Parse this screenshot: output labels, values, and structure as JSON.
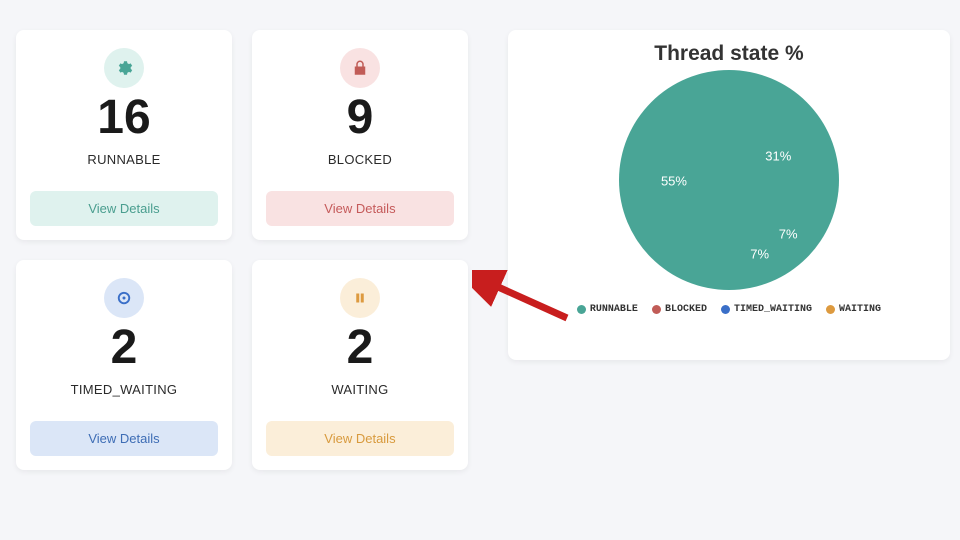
{
  "cards": [
    {
      "id": "runnable",
      "icon": "gear-icon",
      "value": "16",
      "label": "RUNNABLE",
      "button": "View Details",
      "variant": "teal"
    },
    {
      "id": "blocked",
      "icon": "lock-icon",
      "value": "9",
      "label": "BLOCKED",
      "button": "View Details",
      "variant": "red"
    },
    {
      "id": "timed-waiting",
      "icon": "clock-icon",
      "value": "2",
      "label": "TIMED_WAITING",
      "button": "View Details",
      "variant": "blue"
    },
    {
      "id": "waiting",
      "icon": "pause-icon",
      "value": "2",
      "label": "WAITING",
      "button": "View Details",
      "variant": "orange"
    }
  ],
  "chart_data": {
    "type": "pie",
    "title": "Thread state %",
    "series": [
      {
        "name": "RUNNABLE",
        "value": 55,
        "label": "55%",
        "color": "#49a596"
      },
      {
        "name": "BLOCKED",
        "value": 31,
        "label": "31%",
        "color": "#c15c57"
      },
      {
        "name": "TIMED_WAITING",
        "value": 7,
        "label": "7%",
        "color": "#3a6fc8"
      },
      {
        "name": "WAITING",
        "value": 7,
        "label": "7%",
        "color": "#dd9a3f"
      }
    ],
    "legend_position": "bottom"
  },
  "colors": {
    "teal": "#49a596",
    "red": "#c15c57",
    "blue": "#3a6fc8",
    "orange": "#dd9a3f"
  }
}
